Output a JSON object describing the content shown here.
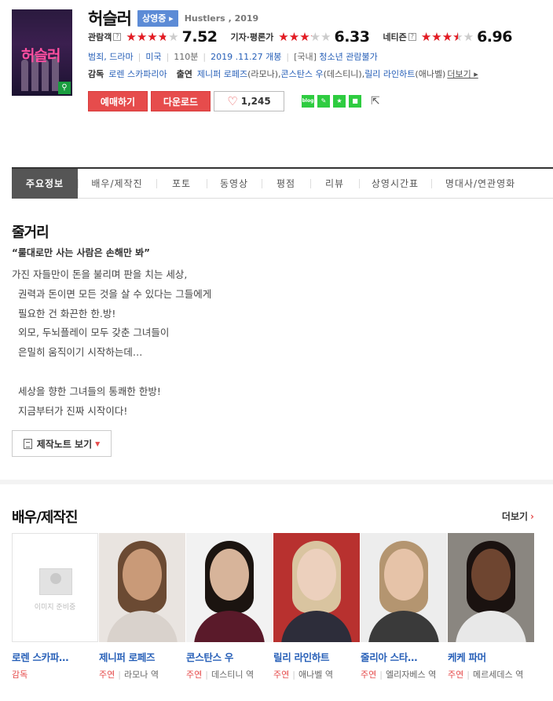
{
  "movie": {
    "poster_title": "허슬러",
    "title": "허슬러",
    "status_badge": "상영중 ▸",
    "eng_title": "Hustlers , 2019"
  },
  "ratings": [
    {
      "label": "관람객",
      "help": "?",
      "score": "7.52",
      "fraction": 0.752
    },
    {
      "label": "기자·평론가",
      "help": "",
      "score": "6.33",
      "fraction": 0.633
    },
    {
      "label": "네티즌",
      "help": "?",
      "score": "6.96",
      "fraction": 0.696
    }
  ],
  "meta": {
    "genre": "범죄, 드라마",
    "country": "미국",
    "runtime": "110분",
    "release": "2019 .11.27 개봉",
    "rating_prefix": "[국내]",
    "rating": "청소년 관람불가",
    "director_label": "감독",
    "director": "로렌 스카파리아",
    "cast_label": "출연",
    "cast_1": "제니퍼 로페즈",
    "cast_1_role": "(라모나), ",
    "cast_2": "콘스탄스 우",
    "cast_2_role": "(데스티니), ",
    "cast_3": "릴리 라인하트",
    "cast_3_role": "(애나벨)",
    "more": "더보기 ▸"
  },
  "buttons": {
    "reserve": "예매하기",
    "download": "다운로드",
    "like_count": "1,245",
    "sns": [
      "blog",
      "band",
      "star",
      "sq"
    ]
  },
  "tabs": [
    "주요정보",
    "배우/제작진",
    "포토",
    "동영상",
    "평점",
    "리뷰",
    "상영시간표",
    "명대사/연관영화"
  ],
  "synopsis": {
    "heading": "줄거리",
    "quote": "“룰대로만 사는 사람은 손해만 봐”",
    "lines": [
      "가진 자들만이 돈을 불리며 판을 치는 세상,",
      "  권력과 돈이면 모든 것을 살 수 있다는 그들에게",
      "  필요한 건 화끈한 한.방!",
      "  외모, 두뇌플레이 모두 갖춘 그녀들이",
      "  은밀히 움직이기 시작하는데…",
      "",
      "  세상을 향한 그녀들의 통쾌한 한방!",
      "  지금부터가 진짜 시작이다!"
    ],
    "note_button": "제작노트 보기"
  },
  "cast_section": {
    "heading": "배우/제작진",
    "more": "더보기",
    "placeholder_text": "이미지 준비중",
    "people": [
      {
        "name": "로렌 스카파…",
        "position": "감독",
        "role": "",
        "photo": "none"
      },
      {
        "name": "제니퍼 로페즈",
        "position": "주연",
        "role": "라모나 역",
        "photo": "#c99a78",
        "bg": "#e9e4e0",
        "hair": "#6b4a33",
        "cloth": "#d9d2cc"
      },
      {
        "name": "콘스탄스 우",
        "position": "주연",
        "role": "데스티니 역",
        "photo": "#d7b49a",
        "bg": "#f2f2f2",
        "hair": "#1b1410",
        "cloth": "#5a1a2a"
      },
      {
        "name": "릴리 라인하트",
        "position": "주연",
        "role": "애나벨 역",
        "photo": "#ecd0bd",
        "bg": "#b8312f",
        "hair": "#d9c4a0",
        "cloth": "#2d2d3a"
      },
      {
        "name": "줄리아 스타…",
        "position": "주연",
        "role": "엘리자베스 역",
        "photo": "#e6c3a8",
        "bg": "#ededed",
        "hair": "#b49570",
        "cloth": "#3a3a3a"
      },
      {
        "name": "케케 파머",
        "position": "주연",
        "role": "메르세데스 역",
        "photo": "#6e4530",
        "bg": "#8a8680",
        "hair": "#1a1210",
        "cloth": "#e8e8e8"
      }
    ]
  }
}
